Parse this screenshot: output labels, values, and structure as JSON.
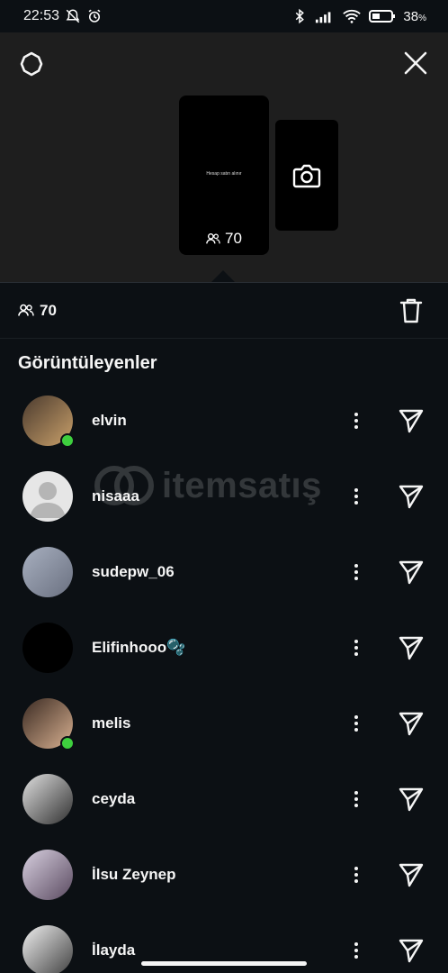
{
  "status_bar": {
    "time": "22:53",
    "battery": "38",
    "battery_unit": "%"
  },
  "story": {
    "preview_text": "Hesap satın alınır",
    "view_count": "70"
  },
  "summary": {
    "view_count": "70"
  },
  "section": {
    "title": "Görüntüleyenler"
  },
  "viewers": [
    {
      "name": "elvin",
      "online": true,
      "avatar_colors": [
        "#4a3a2e",
        "#c9a06a"
      ]
    },
    {
      "name": "nisaaa",
      "online": false,
      "avatar_colors": [
        "#e8e8e8",
        "#b0b0b0"
      ]
    },
    {
      "name": "sudepw_06",
      "online": false,
      "avatar_colors": [
        "#a8b0c0",
        "#6a7080"
      ]
    },
    {
      "name": "Elifinhooo🫧",
      "online": false,
      "avatar_colors": [
        "#000000",
        "#000000"
      ]
    },
    {
      "name": "melis",
      "online": true,
      "avatar_colors": [
        "#3a2a22",
        "#d8b090"
      ]
    },
    {
      "name": "ceyda",
      "online": false,
      "avatar_colors": [
        "#e0e0e0",
        "#303030"
      ]
    },
    {
      "name": "İlsu Zeynep",
      "online": false,
      "avatar_colors": [
        "#d8d0e0",
        "#5a4a60"
      ]
    },
    {
      "name": "İlayda",
      "online": false,
      "avatar_colors": [
        "#f0f0f0",
        "#404040"
      ]
    }
  ],
  "watermark": {
    "text": "itemsatış"
  },
  "colors": {
    "background": "#0c1014",
    "header_bg": "#1e1e1e",
    "online": "#3ecf3e"
  }
}
